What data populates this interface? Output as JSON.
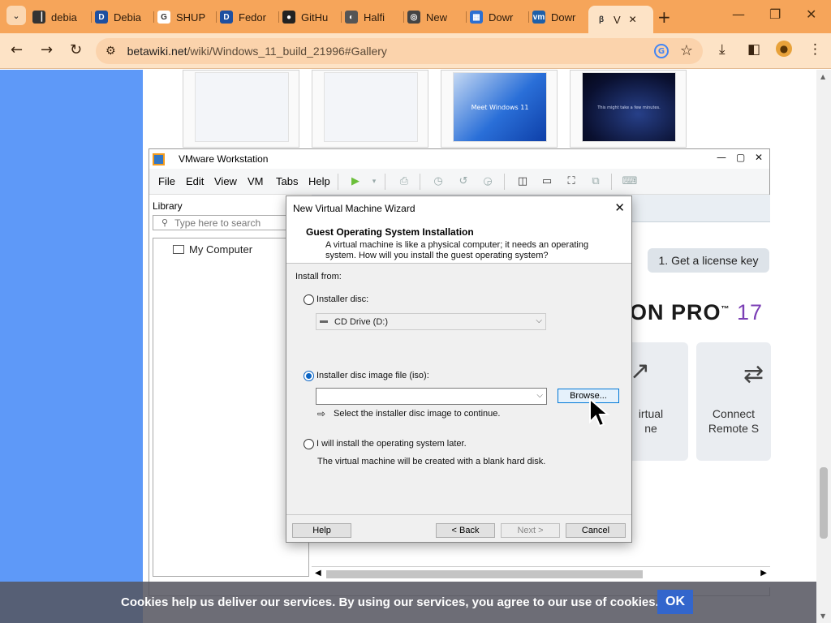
{
  "browser": {
    "tabs": [
      {
        "label": "debia",
        "icon": "archive-icon",
        "icon_color": "#333333",
        "glyph": "▕"
      },
      {
        "label": "Debia",
        "icon": "d-logo-icon",
        "icon_color": "#1d4fa0",
        "glyph": "D"
      },
      {
        "label": "SHUP",
        "icon": "google-icon",
        "icon_color": "#ffffff",
        "glyph": "G"
      },
      {
        "label": "Fedor",
        "icon": "d-logo-icon",
        "icon_color": "#1d4fa0",
        "glyph": "D"
      },
      {
        "label": "GitHu",
        "icon": "github-icon",
        "icon_color": "#222222",
        "glyph": "●"
      },
      {
        "label": "Halfi",
        "icon": "compass-icon",
        "icon_color": "#555555",
        "glyph": "◐"
      },
      {
        "label": "New",
        "icon": "web-icon",
        "icon_color": "#444444",
        "glyph": "◎"
      },
      {
        "label": "Dowr",
        "icon": "windows-icon",
        "icon_color": "#2b6fd1",
        "glyph": "▦"
      },
      {
        "label": "Dowr",
        "icon": "vmware-icon",
        "icon_color": "#1d5fa8",
        "glyph": "vm"
      },
      {
        "label": "V",
        "icon": "betawiki-icon",
        "icon_color": "#fde3c6",
        "glyph": "β"
      }
    ],
    "url_host": "betawiki.net",
    "url_path": "/wiki/Windows_11_build_21996#Gallery",
    "accent": "#f6a55a"
  },
  "gallery": {
    "thumb3_title": "Meet Windows 11",
    "thumb4_text": "This might take a few minutes."
  },
  "vmware": {
    "title": "VMware Workstation",
    "menu": [
      "File",
      "Edit",
      "View",
      "VM",
      "Tabs",
      "Help"
    ],
    "library_title": "Library",
    "search_placeholder": "Type here to search",
    "tree_item": "My Computer",
    "license_button": "1. Get a license key",
    "product_name": "ON PRO",
    "product_version": "17",
    "card1_label_line1": "irtual",
    "card1_label_line2": "ne",
    "card2_label_line1": "Connect",
    "card2_label_line2": "Remote S"
  },
  "wizard": {
    "title": "New Virtual Machine Wizard",
    "heading": "Guest Operating System Installation",
    "description": "A virtual machine is like a physical computer; it needs an operating system. How will you install the guest operating system?",
    "install_from": "Install from:",
    "option_disc": "Installer disc:",
    "disc_value": "CD Drive (D:)",
    "option_iso": "Installer disc image file (iso):",
    "iso_value": "",
    "browse": "Browse...",
    "hint": "Select the installer disc image to continue.",
    "option_later": "I will install the operating system later.",
    "later_desc": "The virtual machine will be created with a blank hard disk.",
    "selected_option": "iso",
    "help": "Help",
    "back": "< Back",
    "next": "Next >",
    "cancel": "Cancel"
  },
  "cookie_bar": {
    "message": "Cookies help us deliver our services. By using our services, you agree to our use of cookies.",
    "ok": "OK"
  }
}
